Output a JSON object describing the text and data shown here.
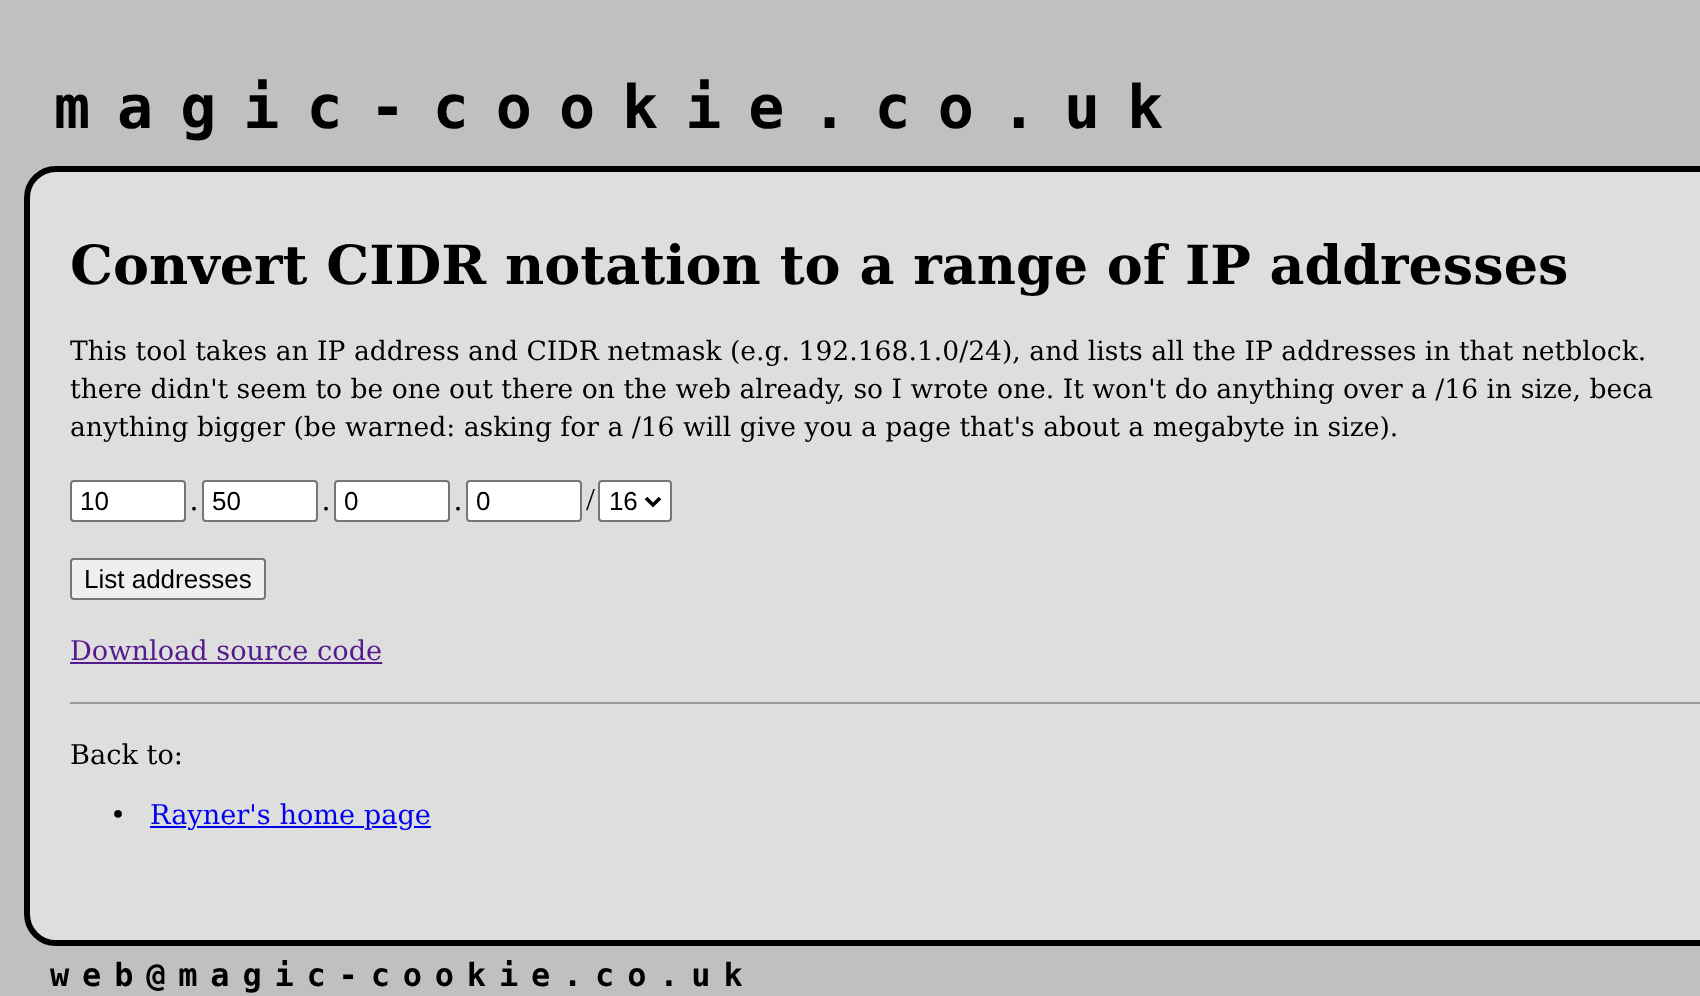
{
  "site_title": "magic-cookie.co.uk",
  "heading": "Convert CIDR notation to a range of IP addresses",
  "intro_lines": [
    "This tool takes an IP address and CIDR netmask (e.g. 192.168.1.0/24), and lists all the IP addresses in that netblock.",
    "there didn't seem to be one out there on the web already, so I wrote one. It won't do anything over a /16 in size, beca",
    "anything bigger (be warned: asking for a /16 will give you a page that's about a megabyte in size)."
  ],
  "form": {
    "octets": [
      {
        "value": "10",
        "separator": "."
      },
      {
        "value": "50",
        "separator": "."
      },
      {
        "value": "0",
        "separator": "."
      },
      {
        "value": "0",
        "separator": "/"
      }
    ],
    "mask": {
      "value": "16"
    },
    "submit": "List addresses"
  },
  "download_link": {
    "label": "Download source code",
    "visited": true
  },
  "back_label": "Back to:",
  "back_links": [
    {
      "marker": "•",
      "label": "Rayner's home page",
      "visited": false
    }
  ],
  "footer_email": "web@magic-cookie.co.uk"
}
